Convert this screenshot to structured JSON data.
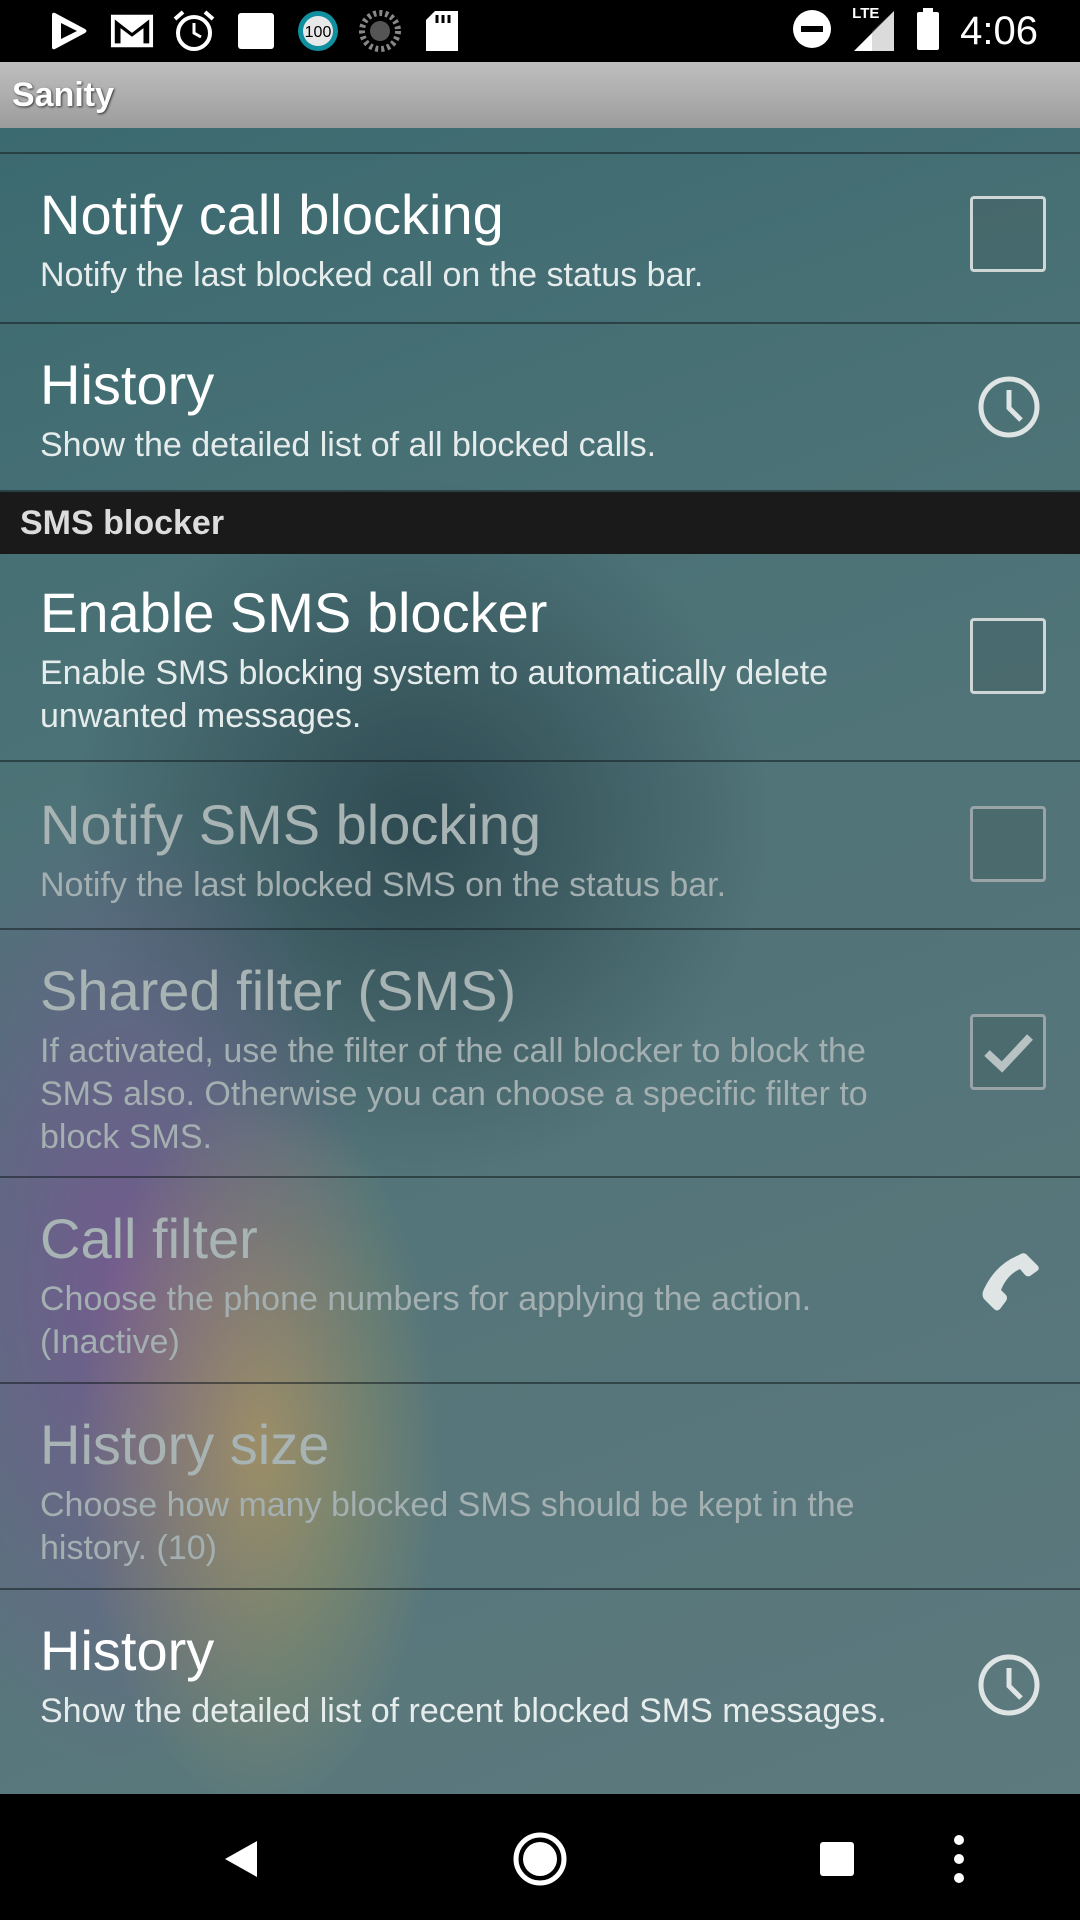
{
  "status_bar": {
    "time": "4:06",
    "notification_badge": "100",
    "network_label": "LTE",
    "icons_left": [
      "play-store-icon",
      "gmail-icon",
      "alarm-icon",
      "square-icon",
      "badge-100-icon",
      "sync-icon",
      "sd-card-icon"
    ],
    "icons_right": [
      "do-not-disturb-icon",
      "lte-signal-icon",
      "battery-icon"
    ]
  },
  "app_bar": {
    "title": "Sanity"
  },
  "preferences": {
    "notify_call": {
      "title": "Notify call blocking",
      "summary": "Notify the last blocked call on the status bar.",
      "checked": false,
      "enabled": true
    },
    "call_history": {
      "title": "History",
      "summary": "Show the detailed list of all blocked calls.",
      "icon": "clock-icon"
    },
    "sms_category": {
      "label": "SMS blocker"
    },
    "enable_sms": {
      "title": "Enable SMS blocker",
      "summary": "Enable SMS blocking system to automatically delete unwanted messages.",
      "checked": false,
      "enabled": true
    },
    "notify_sms": {
      "title": "Notify SMS blocking",
      "summary": "Notify the last blocked SMS on the status bar.",
      "checked": false,
      "enabled": false
    },
    "shared_filter": {
      "title": "Shared filter (SMS)",
      "summary": "If activated, use the filter of the call blocker to block the SMS also. Otherwise you can choose a specific filter to block SMS.",
      "checked": true,
      "enabled": false
    },
    "call_filter": {
      "title": "Call filter",
      "summary": "Choose the phone numbers for applying the action. (Inactive)",
      "icon": "phone-icon",
      "enabled": false
    },
    "history_size": {
      "title": "History size",
      "summary": "Choose how many blocked SMS should be kept in the history. (10)",
      "enabled": false
    },
    "sms_history": {
      "title": "History",
      "summary": "Show the detailed list of recent blocked SMS messages.",
      "icon": "clock-icon"
    }
  },
  "nav_bar": {
    "buttons": [
      "back-icon",
      "home-icon",
      "recents-icon",
      "overflow-menu-icon"
    ]
  },
  "colors": {
    "background_teal": "#4d7377",
    "category_bg": "#1a1a1a",
    "app_bar": "#a9a9a9"
  }
}
